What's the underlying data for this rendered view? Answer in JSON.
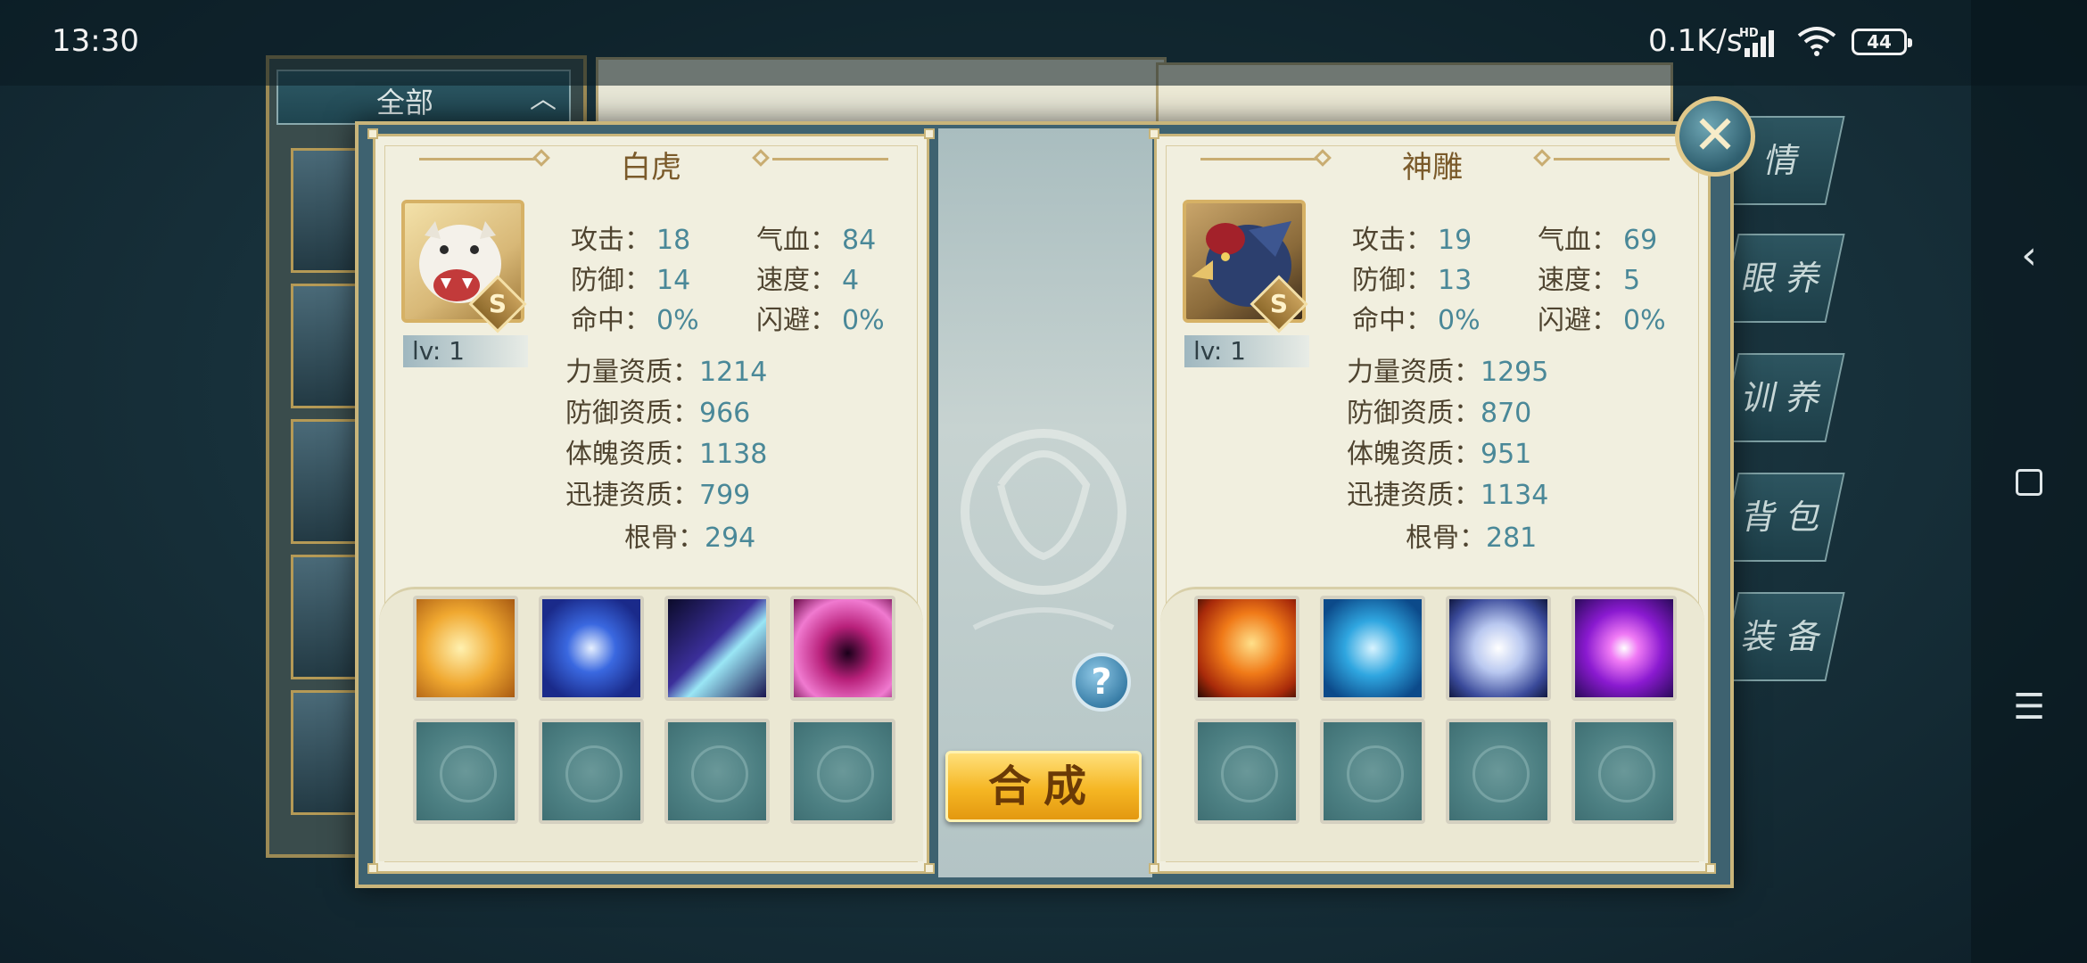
{
  "status_bar": {
    "time": "13:30",
    "net_speed": "0.1K/s",
    "network_badge": "HD",
    "battery": "44"
  },
  "background": {
    "filter_label": "全部",
    "tabs": [
      "情",
      "眼 养",
      "训 养",
      "背 包",
      "装 备"
    ]
  },
  "dialog": {
    "combine_label": "合成",
    "help_label": "?",
    "close_label": "✕",
    "left_pet": {
      "name": "白虎",
      "rank": "S",
      "level": "lv: 1",
      "stats": {
        "attack_label": "攻击：",
        "attack": "18",
        "hp_label": "气血：",
        "hp": "84",
        "defense_label": "防御：",
        "defense": "14",
        "speed_label": "速度：",
        "speed": "4",
        "hit_label": "命中：",
        "hit": "0%",
        "dodge_label": "闪避：",
        "dodge": "0%",
        "power_apt_label": "力量资质：",
        "power_apt": "1214",
        "def_apt_label": "防御资质：",
        "def_apt": "966",
        "body_apt_label": "体魄资质：",
        "body_apt": "1138",
        "agility_apt_label": "迅捷资质：",
        "agility_apt": "799",
        "bone_label": "根骨：",
        "bone": "294"
      },
      "skills": [
        "golden-lion-skill",
        "blue-vortex-skill",
        "claw-slash-skill",
        "pink-vortex-skill"
      ]
    },
    "right_pet": {
      "name": "神雕",
      "rank": "S",
      "level": "lv: 1",
      "stats": {
        "attack_label": "攻击：",
        "attack": "19",
        "hp_label": "气血：",
        "hp": "69",
        "defense_label": "防御：",
        "defense": "13",
        "speed_label": "速度：",
        "speed": "5",
        "hit_label": "命中：",
        "hit": "0%",
        "dodge_label": "闪避：",
        "dodge": "0%",
        "power_apt_label": "力量资质：",
        "power_apt": "1295",
        "def_apt_label": "防御资质：",
        "def_apt": "870",
        "body_apt_label": "体魄资质：",
        "body_apt": "951",
        "agility_apt_label": "迅捷资质：",
        "agility_apt": "1134",
        "bone_label": "根骨：",
        "bone": "281"
      },
      "skills": [
        "fire-phoenix-skill",
        "blue-crossed-blades-skill",
        "white-orb-skill",
        "purple-orb-skill"
      ]
    }
  }
}
